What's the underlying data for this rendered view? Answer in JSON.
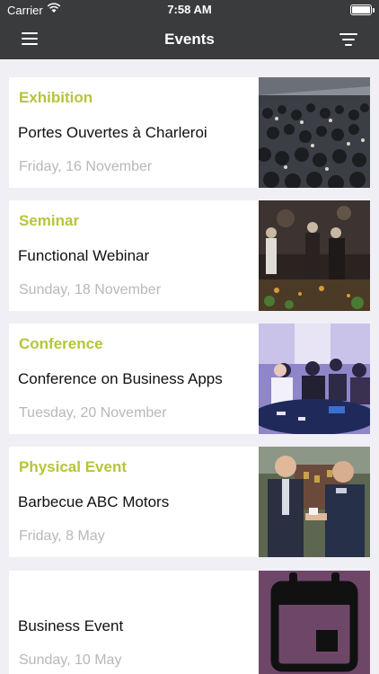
{
  "status_bar": {
    "carrier": "Carrier",
    "time": "7:58 AM",
    "battery_level": 1.0
  },
  "nav": {
    "title": "Events",
    "menu_icon": "hamburger-menu-icon",
    "filter_icon": "filter-icon"
  },
  "events": [
    {
      "category": "Exhibition",
      "name": "Portes Ouvertes à Charleroi",
      "date": "Friday, 16 November",
      "image": "crowd-photo"
    },
    {
      "category": "Seminar",
      "name": "Functional Webinar",
      "date": "Sunday, 18 November",
      "image": "reception-photo"
    },
    {
      "category": "Conference",
      "name": "Conference on Business Apps",
      "date": "Tuesday, 20 November",
      "image": "conference-photo"
    },
    {
      "category": "Physical Event",
      "name": "Barbecue ABC Motors",
      "date": "Friday, 8 May",
      "image": "handshake-photo"
    },
    {
      "category": "",
      "name": "Business Event",
      "date": "Sunday, 10 May",
      "image": "calendar-icon"
    }
  ],
  "colors": {
    "bar": "#3a3b3d",
    "accent": "#b6c43a",
    "background": "#f0eff5",
    "calendar_bg": "#6e4768"
  }
}
